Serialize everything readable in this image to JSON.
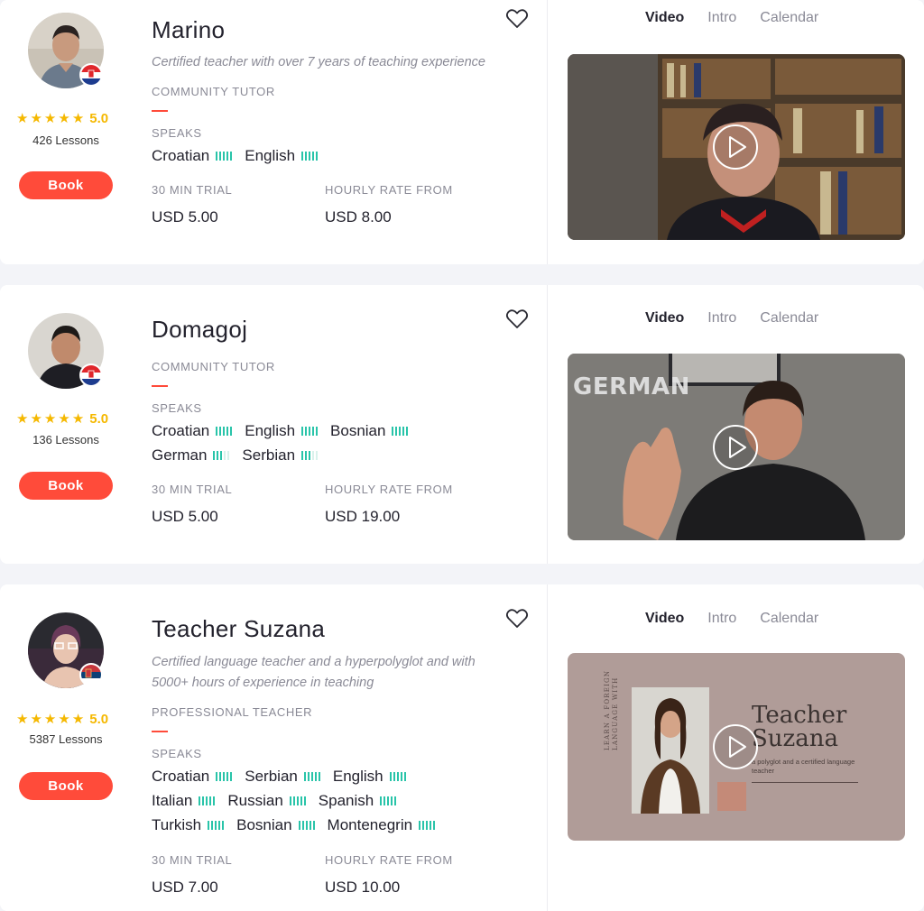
{
  "tutors": [
    {
      "name": "Marino",
      "description": "Certified teacher with over 7 years of teaching experience",
      "tutor_type": "COMMUNITY TUTOR",
      "rating": "5.0",
      "lessons": "426 Lessons",
      "book_label": "Book",
      "speaks_label": "SPEAKS",
      "languages": [
        {
          "name": "Croatian",
          "level": 5
        },
        {
          "name": "English",
          "level": 5
        }
      ],
      "trial_label": "30 MIN TRIAL",
      "trial_price": "USD 5.00",
      "rate_label": "HOURLY RATE FROM",
      "rate_price": "USD 8.00",
      "flag": "croatia-flag",
      "tabs": [
        "Video",
        "Intro",
        "Calendar"
      ],
      "active_tab": "Video",
      "video_text": ""
    },
    {
      "name": "Domagoj",
      "description": "",
      "tutor_type": "COMMUNITY TUTOR",
      "rating": "5.0",
      "lessons": "136 Lessons",
      "book_label": "Book",
      "speaks_label": "SPEAKS",
      "languages": [
        {
          "name": "Croatian",
          "level": 5
        },
        {
          "name": "English",
          "level": 5
        },
        {
          "name": "Bosnian",
          "level": 5
        },
        {
          "name": "German",
          "level": 3
        },
        {
          "name": "Serbian",
          "level": 3
        }
      ],
      "trial_label": "30 MIN TRIAL",
      "trial_price": "USD 5.00",
      "rate_label": "HOURLY RATE FROM",
      "rate_price": "USD 19.00",
      "flag": "croatia-flag",
      "tabs": [
        "Video",
        "Intro",
        "Calendar"
      ],
      "active_tab": "Video",
      "video_text": "GERMAN"
    },
    {
      "name": "Teacher Suzana",
      "description": "Certified language teacher and a hyperpolyglot and with 5000+ hours of experience in teaching",
      "tutor_type": "PROFESSIONAL TEACHER",
      "rating": "5.0",
      "lessons": "5387 Lessons",
      "book_label": "Book",
      "speaks_label": "SPEAKS",
      "languages": [
        {
          "name": "Croatian",
          "level": 5
        },
        {
          "name": "Serbian",
          "level": 5
        },
        {
          "name": "English",
          "level": 5
        },
        {
          "name": "Italian",
          "level": 5
        },
        {
          "name": "Russian",
          "level": 5
        },
        {
          "name": "Spanish",
          "level": 5
        },
        {
          "name": "Turkish",
          "level": 5
        },
        {
          "name": "Bosnian",
          "level": 5
        },
        {
          "name": "Montenegrin",
          "level": 5
        }
      ],
      "trial_label": "30 MIN TRIAL",
      "trial_price": "USD 7.00",
      "rate_label": "HOURLY RATE FROM",
      "rate_price": "USD 10.00",
      "flag": "serbia-flag",
      "tabs": [
        "Video",
        "Intro",
        "Calendar"
      ],
      "active_tab": "Video",
      "video_title_line1": "Teacher",
      "video_title_line2": "Suzana",
      "video_subtitle": "a polyglot and a certified language teacher",
      "video_side_text": "LEARN A FOREIGN LANGUAGE WITH"
    }
  ],
  "colors": {
    "accent": "#ff4b3a",
    "star": "#f5b800",
    "level_bar": "#29c4a9"
  }
}
